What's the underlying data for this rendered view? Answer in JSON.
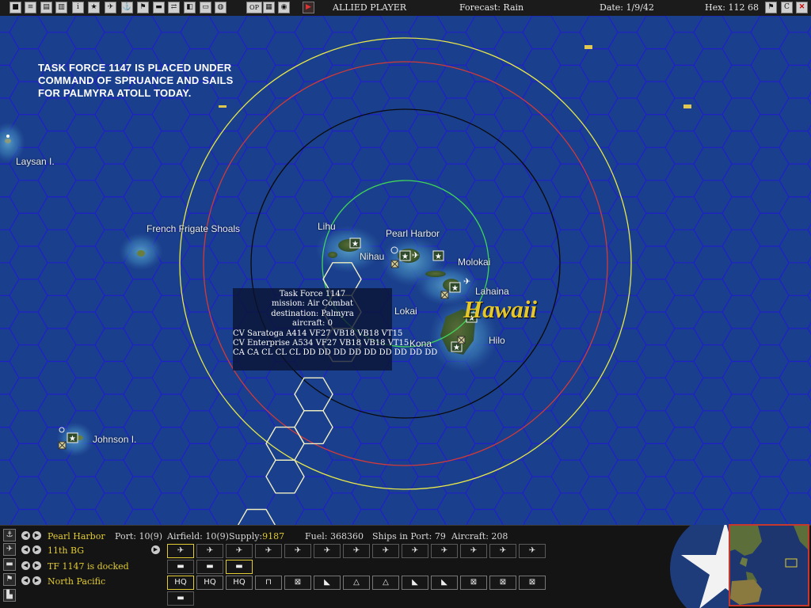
{
  "toolbar": {
    "buttons": [
      {
        "name": "save-icon",
        "glyph": "■"
      },
      {
        "name": "document-icon",
        "glyph": "≡"
      },
      {
        "name": "report-icon",
        "glyph": "▤"
      },
      {
        "name": "list-icon",
        "glyph": "▥"
      },
      {
        "name": "info-icon",
        "glyph": "i"
      },
      {
        "name": "star-icon",
        "glyph": "★"
      },
      {
        "name": "plane-icon",
        "glyph": "✈"
      },
      {
        "name": "ship-icon",
        "glyph": "⚓"
      },
      {
        "name": "flag-icon",
        "glyph": "⚑"
      },
      {
        "name": "carrier-icon",
        "glyph": "▬"
      },
      {
        "name": "route-icon",
        "glyph": "⇄"
      },
      {
        "name": "weather-icon",
        "glyph": "◧"
      },
      {
        "name": "sub-icon",
        "glyph": "▭"
      },
      {
        "name": "globe-icon",
        "glyph": "◍"
      },
      {
        "name": "op-button",
        "glyph": "OP"
      },
      {
        "name": "filter-icon",
        "glyph": "▦"
      },
      {
        "name": "sphere-icon",
        "glyph": "◉"
      },
      {
        "name": "end-turn-icon",
        "glyph": "▶"
      }
    ],
    "player": "ALLIED PLAYER",
    "forecast": "Forecast: Rain",
    "date": "Date: 1/9/42",
    "hex": "Hex: 112 68",
    "right_buttons": [
      {
        "name": "flag-icon",
        "glyph": "⚑"
      },
      {
        "name": "c-button",
        "glyph": "C"
      },
      {
        "name": "close-icon",
        "glyph": "✕"
      }
    ]
  },
  "message": [
    "TASK FORCE 1147 IS PLACED UNDER",
    "COMMAND OF SPRUANCE AND SAILS",
    "FOR PALMYRA ATOLL TODAY."
  ],
  "places": {
    "laysan": "Laysan I.",
    "french_frigate": "French Frigate Shoals",
    "lihu": "Lihu",
    "nihau": "Nihau",
    "pearl_harbor": "Pearl Harbor",
    "molokai": "Molokai",
    "lahaina": "Lahaina",
    "lokai": "Lokai",
    "kona": "Kona",
    "hilo": "Hilo",
    "johnson": "Johnson I.",
    "hawaii": "Hawaii"
  },
  "task_force": {
    "lines": [
      "Task Force 1147",
      "mission: Air Combat",
      "destination: Palmyra",
      "aircraft: 0",
      "CV Saratoga  A414  VF27  VB18  VB18  VT15",
      "CV Enterprise  A534  VF27  VB18  VB18  VT15",
      "CA CA CL CL CL DD DD DD DD DD DD DD DD DD"
    ]
  },
  "bottom": {
    "base": "Pearl Harbor",
    "port": "Port: 10(9)",
    "airfield": "Airfield: 10(9)",
    "supply_label": "Supply:",
    "supply_value": "9187",
    "fuel": "Fuel: 368360",
    "ships_in_port": "Ships in Port: 79",
    "aircraft": "Aircraft: 208",
    "air_unit": "11th BG",
    "tf_status": "TF 1147 is docked",
    "command": "North Pacific",
    "aircraft_units": 13,
    "ship_units": 3,
    "hq_units": [
      "HQ",
      "HQ",
      "HQ",
      "⊓",
      "⊠",
      "◣",
      "△",
      "△",
      "◣",
      "◣",
      "⊠",
      "⊠",
      "⊠"
    ]
  },
  "colors": {
    "ocean": "#1a3f8c",
    "hex_grid": "#2020c8",
    "accent_yellow": "#e2cc33",
    "ring_yellow": "#e8e84a",
    "ring_red": "#d03a3a",
    "ring_black": "#0a0a0a",
    "ring_green": "#3fd45a"
  }
}
